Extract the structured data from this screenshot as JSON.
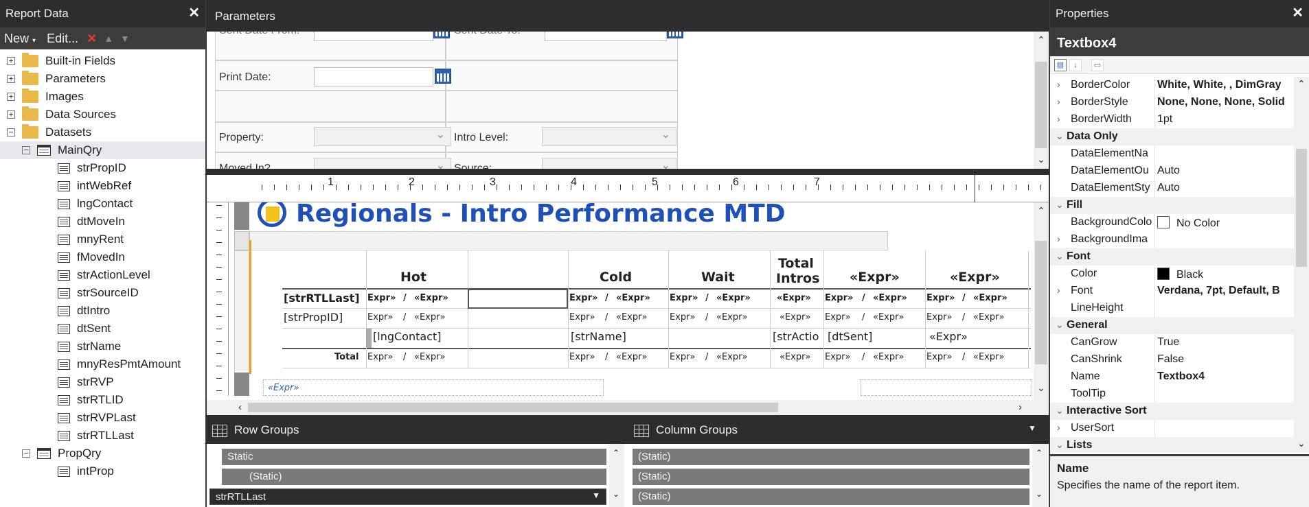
{
  "report_data": {
    "title": "Report Data",
    "toolbar": {
      "new": "New",
      "edit": "Edit..."
    },
    "tree": [
      {
        "label": "Built-in Fields",
        "type": "folder",
        "level": 0,
        "expander": "+"
      },
      {
        "label": "Parameters",
        "type": "folder",
        "level": 0,
        "expander": "+"
      },
      {
        "label": "Images",
        "type": "folder",
        "level": 0,
        "expander": "+"
      },
      {
        "label": "Data Sources",
        "type": "folder",
        "level": 0,
        "expander": "+"
      },
      {
        "label": "Datasets",
        "type": "folder",
        "level": 0,
        "expander": "−"
      },
      {
        "label": "MainQry",
        "type": "table",
        "level": 1,
        "expander": "−",
        "selected": true
      },
      {
        "label": "strPropID",
        "type": "field",
        "level": 2
      },
      {
        "label": "intWebRef",
        "type": "field",
        "level": 2
      },
      {
        "label": "lngContact",
        "type": "field",
        "level": 2
      },
      {
        "label": "dtMoveIn",
        "type": "field",
        "level": 2
      },
      {
        "label": "mnyRent",
        "type": "field",
        "level": 2
      },
      {
        "label": "fMovedIn",
        "type": "field",
        "level": 2
      },
      {
        "label": "strActionLevel",
        "type": "field",
        "level": 2
      },
      {
        "label": "strSourceID",
        "type": "field",
        "level": 2
      },
      {
        "label": "dtIntro",
        "type": "field",
        "level": 2
      },
      {
        "label": "dtSent",
        "type": "field",
        "level": 2
      },
      {
        "label": "strName",
        "type": "field",
        "level": 2
      },
      {
        "label": "mnyResPmtAmount",
        "type": "field",
        "level": 2
      },
      {
        "label": "strRVP",
        "type": "field",
        "level": 2
      },
      {
        "label": "strRTLID",
        "type": "field",
        "level": 2
      },
      {
        "label": "strRVPLast",
        "type": "field",
        "level": 2
      },
      {
        "label": "strRTLLast",
        "type": "field",
        "level": 2
      },
      {
        "label": "PropQry",
        "type": "table",
        "level": 1,
        "expander": "−"
      },
      {
        "label": "intProp",
        "type": "field",
        "level": 2
      }
    ]
  },
  "parameters": {
    "title": "Parameters",
    "sent_from": "Sent Date From:",
    "sent_to": "Sent Date To:",
    "print_date": "Print Date:",
    "property": "Property:",
    "intro_level": "Intro Level:",
    "moved_in": "Moved In?",
    "source": "Source:"
  },
  "ruler": [
    "1",
    "2",
    "3",
    "4",
    "5",
    "6",
    "7"
  ],
  "report": {
    "title": "Regionals - Intro Performance MTD",
    "subtitle_expr": "«Expr»",
    "headers": {
      "hot": "Hot",
      "cold": "Cold",
      "wait": "Wait",
      "total1": "Total",
      "total2": "Intros",
      "expr": "«Expr»"
    },
    "row1": {
      "label": "[strRTLLast]",
      "a": "Expr»",
      "sl": "/",
      "b": "«Expr»",
      "c": "«Expr»"
    },
    "row2": {
      "label": "[strPropID]",
      "a": "Expr»",
      "sl": "/",
      "b": "«Expr»",
      "c": "«Expr»"
    },
    "row3": {
      "contact": "[lngContact]",
      "name": "[strName]",
      "action": "[strActio",
      "sent": "[dtSent]",
      "expr": "«Expr»"
    },
    "row4": {
      "label": "Total",
      "a": "Expr»",
      "sl": "/",
      "b": "«Expr»",
      "c": "«Expr»"
    },
    "footer_expr": "«Expr»"
  },
  "groups": {
    "row_title": "Row Groups",
    "col_title": "Column Groups",
    "rows": [
      "Static",
      "(Static)",
      "strRTLLast"
    ],
    "cols": [
      "(Static)",
      "(Static)",
      "(Static)"
    ]
  },
  "properties": {
    "title": "Properties",
    "object": "Textbox4",
    "rows": [
      {
        "name": "BorderColor",
        "value": "White, White, , DimGray",
        "bold": true,
        "chev": true
      },
      {
        "name": "BorderStyle",
        "value": "None, None, None, Solid",
        "bold": true,
        "chev": true
      },
      {
        "name": "BorderWidth",
        "value": "1pt",
        "chev": true
      },
      {
        "name": "Data Only",
        "cat": true
      },
      {
        "name": "DataElementNa",
        "value": ""
      },
      {
        "name": "DataElementOu",
        "value": "Auto"
      },
      {
        "name": "DataElementSty",
        "value": "Auto"
      },
      {
        "name": "Fill",
        "cat": true
      },
      {
        "name": "BackgroundColo",
        "value": "No Color",
        "swatch": "#ffffff"
      },
      {
        "name": "BackgroundIma",
        "value": "",
        "chev": true
      },
      {
        "name": "Font",
        "cat": true
      },
      {
        "name": "Color",
        "value": "Black",
        "swatch": "#000000"
      },
      {
        "name": "Font",
        "value": "Verdana, 7pt, Default, B",
        "bold": true,
        "chev": true
      },
      {
        "name": "LineHeight",
        "value": ""
      },
      {
        "name": "General",
        "cat": true
      },
      {
        "name": "CanGrow",
        "value": "True"
      },
      {
        "name": "CanShrink",
        "value": "False"
      },
      {
        "name": "Name",
        "value": "Textbox4",
        "bold": true
      },
      {
        "name": "ToolTip",
        "value": ""
      },
      {
        "name": "Interactive Sort",
        "cat": true
      },
      {
        "name": "UserSort",
        "value": "",
        "chev": true
      },
      {
        "name": "Lists",
        "cat": true
      }
    ],
    "desc_name": "Name",
    "desc_text": "Specifies the name of the report item."
  },
  "colors": {
    "accent_orange": "#e8a317",
    "title_blue": "#1f4fb8",
    "chrome": "#2d2d2d"
  }
}
